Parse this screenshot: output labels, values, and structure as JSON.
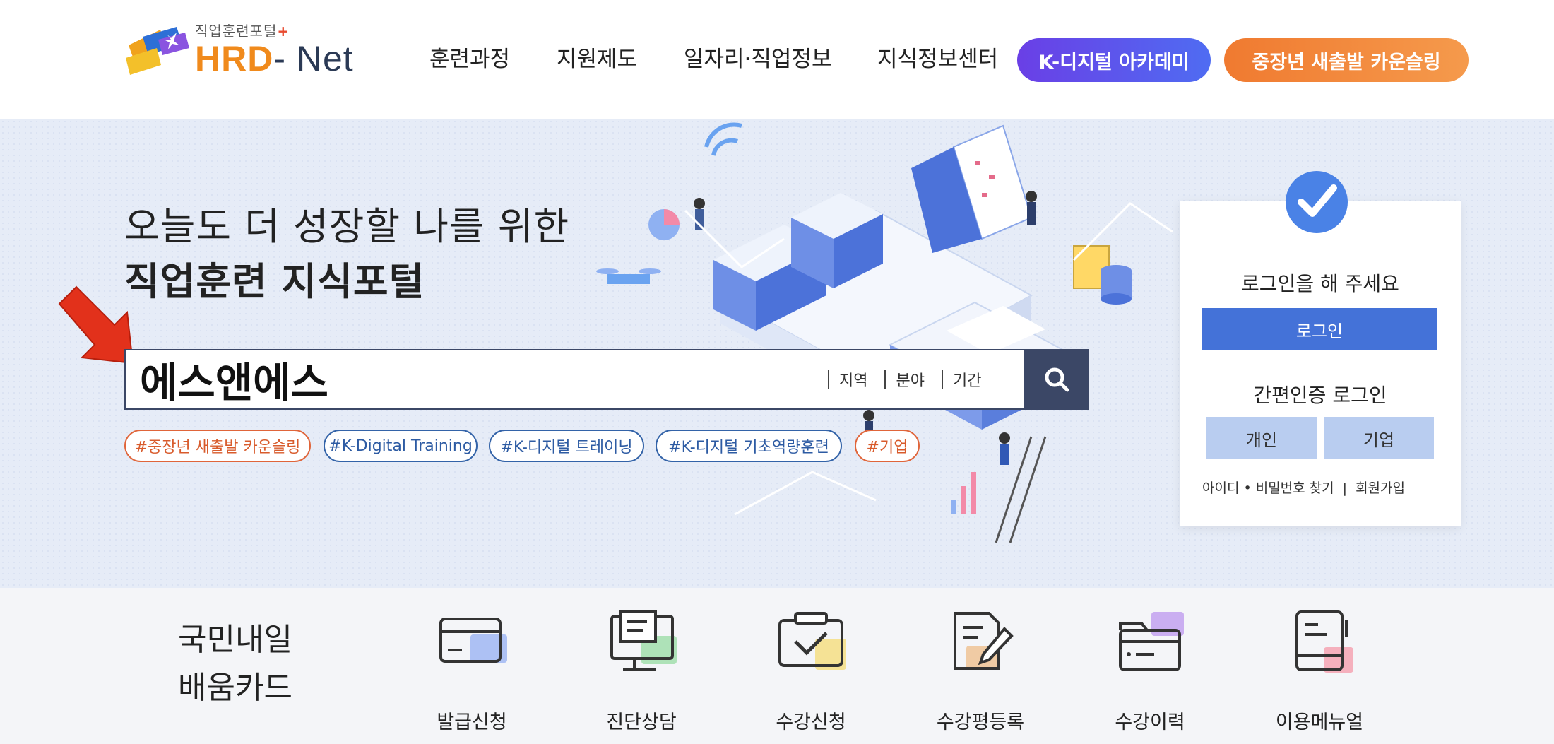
{
  "header": {
    "logo_small": "직업훈련포털",
    "logo_plus": "+",
    "logo_hrd": "HRD",
    "logo_net": "- Net",
    "nav": [
      "훈련과정",
      "지원제도",
      "일자리·직업정보",
      "지식정보센터"
    ],
    "pill_kdigital": "K-디지털 아카데미",
    "pill_senior": "중장년 새출발 카운슬링",
    "colors": {
      "purple": "#6a3fe6",
      "orange": "#f07a30"
    }
  },
  "hero": {
    "title_line1": "오늘도 더 성장할 나를 위한",
    "title_line2": "직업훈련 지식포털",
    "search": {
      "value": "에스앤에스",
      "filters": [
        "지역",
        "분야",
        "기간"
      ]
    },
    "tags": [
      "#중장년 새출발 카운슬링",
      "#K-Digital Training",
      "#K-디지털 트레이닝",
      "#K-디지털 기초역량훈련",
      "#기업"
    ]
  },
  "login": {
    "title": "로그인을 해 주세요",
    "login_button": "로그인",
    "easy_title": "간편인증 로그인",
    "personal": "개인",
    "company": "기업",
    "find_link": "아이디 • 비밀번호 찾기",
    "separator": "|",
    "signup_link": "회원가입",
    "accent": "#4472d8"
  },
  "bottom": {
    "card_title_line1": "국민내일",
    "card_title_line2": "배움카드",
    "items": [
      {
        "label": "발급신청",
        "icon": "card-icon"
      },
      {
        "label": "진단상담",
        "icon": "monitor-icon"
      },
      {
        "label": "수강신청",
        "icon": "checkbox-icon"
      },
      {
        "label": "수강평등록",
        "icon": "edit-document-icon"
      },
      {
        "label": "수강이력",
        "icon": "folder-icon"
      },
      {
        "label": "이용메뉴얼",
        "icon": "manual-icon"
      }
    ]
  }
}
